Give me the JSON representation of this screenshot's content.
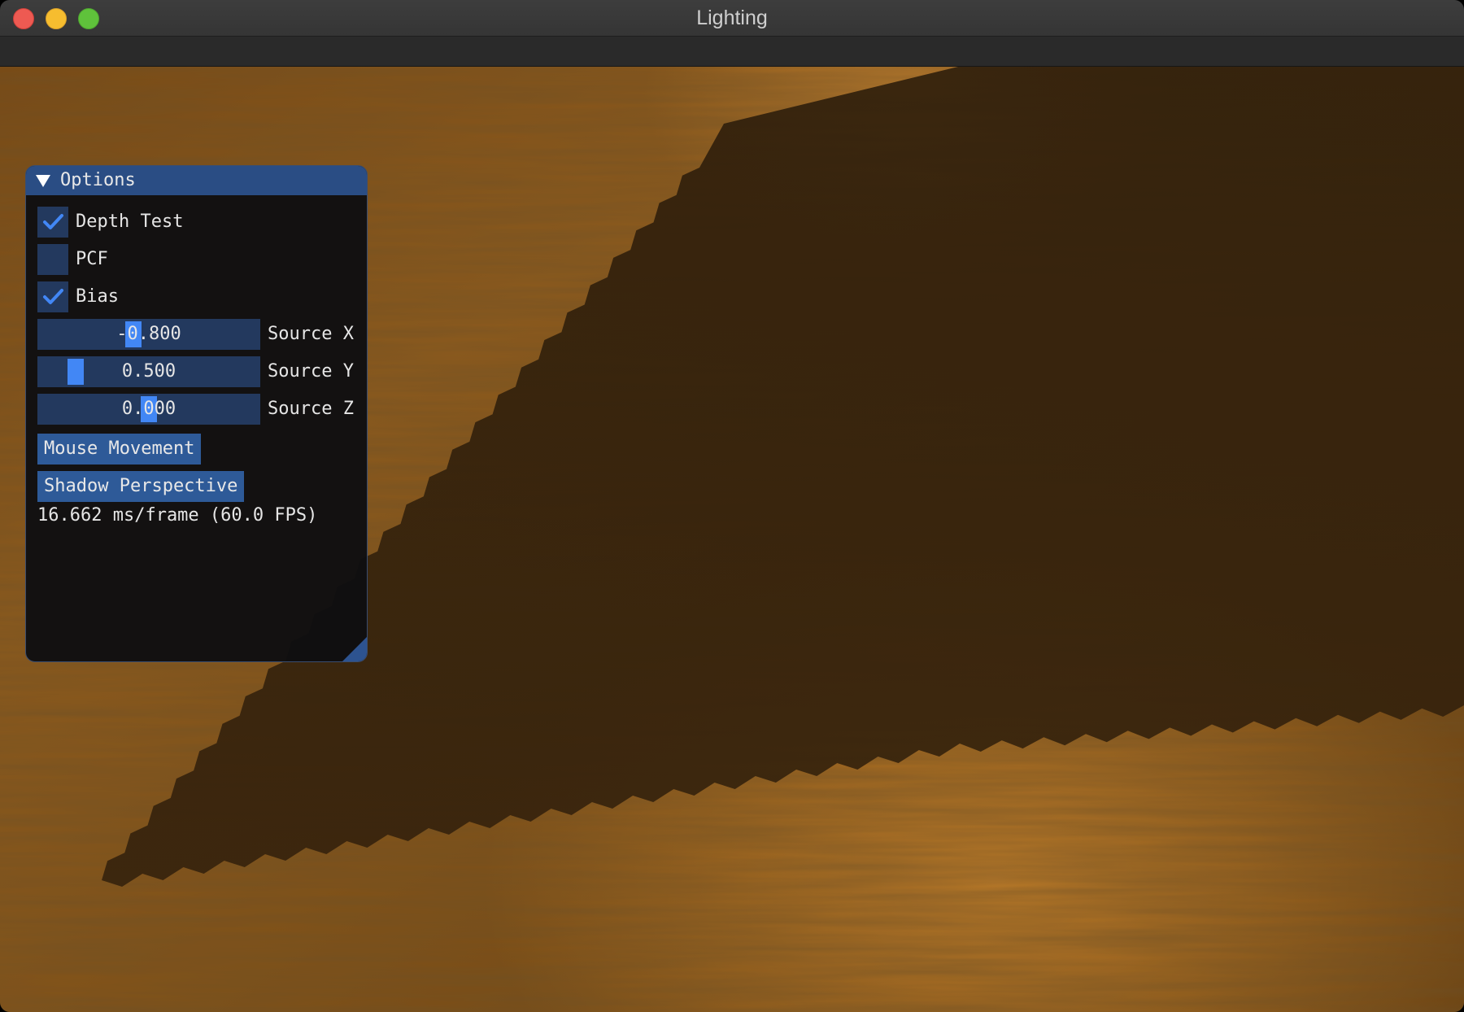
{
  "window": {
    "title": "Lighting"
  },
  "panel": {
    "title": "Options",
    "checkboxes": [
      {
        "label": "Depth Test",
        "checked": true
      },
      {
        "label": "PCF",
        "checked": false
      },
      {
        "label": "Bias",
        "checked": true
      }
    ],
    "sliders": [
      {
        "label": "Source X",
        "value": "-0.800"
      },
      {
        "label": "Source Y",
        "value": "0.500"
      },
      {
        "label": "Source Z",
        "value": "0.000"
      }
    ],
    "buttons": {
      "mouse_movement": "Mouse Movement",
      "shadow_perspective": "Shadow Perspective"
    },
    "fps_text": "16.662 ms/frame (60.0 FPS)"
  },
  "colors": {
    "accent": "#4287f5",
    "panel_header": "#2a4d84",
    "widget_bg": "#23395e",
    "button_bg": "#2e5a98",
    "wood": "#8a5a1a",
    "shadow": "#2e1f0c"
  },
  "icons": {
    "collapse": "triangle-down-icon",
    "check": "checkmark-icon"
  }
}
